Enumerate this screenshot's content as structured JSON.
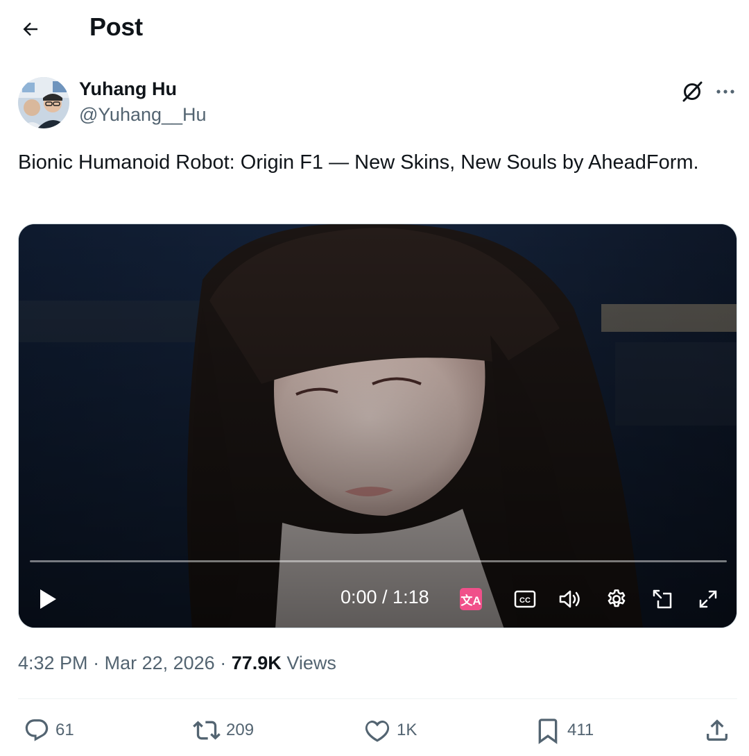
{
  "header": {
    "title": "Post",
    "back_icon": "arrow-left-icon"
  },
  "author": {
    "name": "Yuhang Hu",
    "handle": "@Yuhang__Hu"
  },
  "post": {
    "text": "Bionic Humanoid Robot: Origin F1 — New Skins, New Souls by AheadForm."
  },
  "video": {
    "current_time": "0:00",
    "duration": "1:18",
    "time_display": "0:00 / 1:18",
    "progress": 0,
    "controls": [
      "play-icon",
      "translate-icon",
      "captions-icon",
      "volume-icon",
      "settings-icon",
      "pip-icon",
      "fullscreen-icon"
    ]
  },
  "meta": {
    "time": "4:32 PM",
    "separator": "·",
    "date": "Mar 22, 2026",
    "views_count": "77.9K",
    "views_label": "Views"
  },
  "actions": {
    "replies": "61",
    "reposts": "209",
    "likes": "1K",
    "bookmarks": "411"
  },
  "colors": {
    "text_primary": "#0f1419",
    "text_secondary": "#536471",
    "accent": "#1d9bf0",
    "translate_badge": "#f0508a"
  }
}
